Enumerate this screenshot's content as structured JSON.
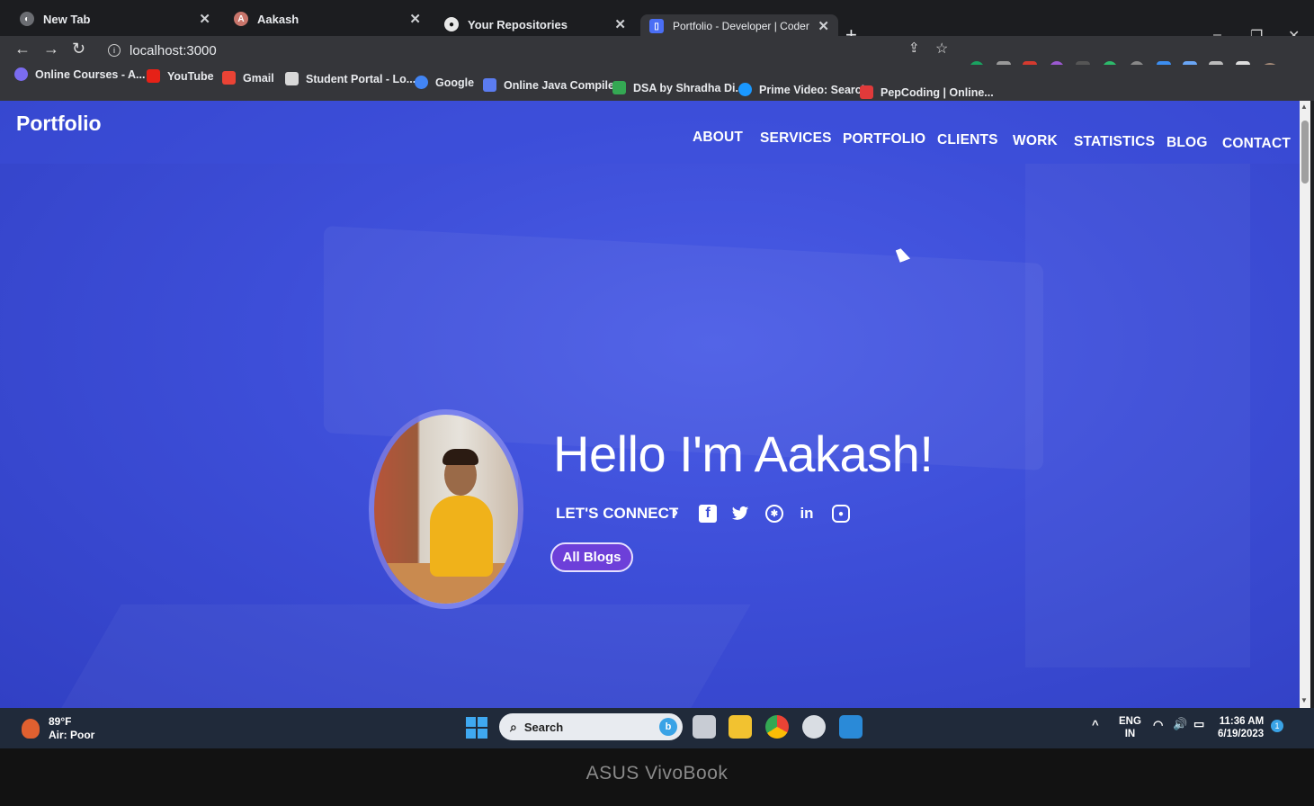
{
  "browser": {
    "tabs": [
      {
        "title": "New Tab",
        "icon": "chrome-icon"
      },
      {
        "title": "Aakash",
        "icon": "app-icon"
      },
      {
        "title": "Your Repositories",
        "icon": "github-icon"
      },
      {
        "title": "Portfolio - Developer | Coder | Sc",
        "icon": "page-icon",
        "active": true
      }
    ],
    "new_tab": "+",
    "url": "localhost:3000",
    "window_controls": {
      "dropdown": "⌄",
      "minimize": "–",
      "restore": "❐",
      "close": "✕"
    },
    "bookmarks": [
      {
        "label": "Online Courses - A...",
        "color": "#7b6cf0"
      },
      {
        "label": "YouTube",
        "color": "#e62117"
      },
      {
        "label": "Gmail",
        "color": "#ea4335"
      },
      {
        "label": "Student Portal - Lo...",
        "color": "#d8d8d8"
      },
      {
        "label": "Google",
        "color": "#4285f4"
      },
      {
        "label": "Online Java Compiler",
        "color": "#5b7cf0"
      },
      {
        "label": "DSA by Shradha Di...",
        "color": "#34a853"
      },
      {
        "label": "Prime Video: Search",
        "color": "#1a98ff"
      },
      {
        "label": "PepCoding | Online...",
        "color": "#e03a3a"
      }
    ]
  },
  "site": {
    "brand": "Portfolio",
    "nav": [
      "ABOUT",
      "SERVICES",
      "PORTFOLIO",
      "CLIENTS",
      "WORK",
      "STATISTICS",
      "BLOG",
      "CONTACT"
    ],
    "hero_title": "Hello I'm Aakash!",
    "connect_label": "LET'S CONNECT",
    "socials": [
      {
        "name": "facebook",
        "glyph": "f"
      },
      {
        "name": "twitter",
        "glyph": "🐦"
      },
      {
        "name": "dribbble",
        "glyph": "⚽"
      },
      {
        "name": "linkedin",
        "glyph": "in"
      },
      {
        "name": "instagram",
        "glyph": "◎"
      }
    ],
    "blogs_button": "All Blogs",
    "colors": {
      "hero_bg": "#3d4ed8",
      "button": "#6d3fd9"
    }
  },
  "taskbar": {
    "weather_temp": "89°F",
    "weather_desc": "Air: Poor",
    "search_label": "Search",
    "lang_top": "ENG",
    "lang_bottom": "IN",
    "time": "11:36 AM",
    "date": "6/19/2023"
  },
  "device": {
    "brand": "ASUS VivoBook"
  }
}
